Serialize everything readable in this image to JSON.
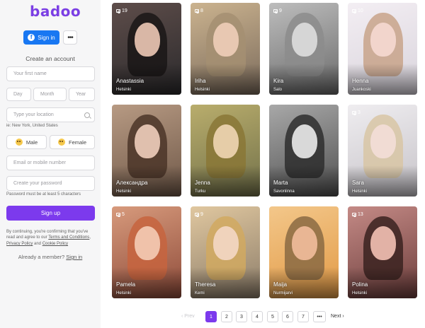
{
  "sidebar": {
    "logo": "badoo",
    "facebook_label": "Sign in",
    "more_label": "•••",
    "create_title": "Create an account",
    "first_name_placeholder": "Your first name",
    "day_placeholder": "Day",
    "month_placeholder": "Month",
    "year_placeholder": "Year",
    "location_placeholder": "Type your location",
    "location_hint": "ie: New York, United States",
    "male_label": "Male",
    "female_label": "Female",
    "email_placeholder": "Email or mobile number",
    "password_placeholder": "Create your password",
    "password_hint": "Password must be at least 5 characters",
    "signup_label": "Sign up",
    "legal_prefix": "By continuing, you're confirming that you've read and agree to our ",
    "terms_label": "Terms and Conditions",
    "legal_sep": ", ",
    "privacy_label": "Privacy Policy",
    "legal_and": " and ",
    "cookie_label": "Cookie Policy",
    "member_prefix": "Already a member? ",
    "member_link": "Sign in"
  },
  "profiles": [
    {
      "name": "Anastassia",
      "city": "Helsinki",
      "photos": "19"
    },
    {
      "name": "Iriha",
      "city": "Helsinki",
      "photos": "8"
    },
    {
      "name": "Kira",
      "city": "Salo",
      "photos": "9"
    },
    {
      "name": "Henna",
      "city": "Juankoski",
      "photos": "10"
    },
    {
      "name": "Александра",
      "city": "Helsinki",
      "photos": ""
    },
    {
      "name": "Jenna",
      "city": "Turku",
      "photos": ""
    },
    {
      "name": "Marta",
      "city": "Savonlinna",
      "photos": ""
    },
    {
      "name": "Sara",
      "city": "Helsinki",
      "photos": "3"
    },
    {
      "name": "Pamela",
      "city": "Helsinki",
      "photos": "5"
    },
    {
      "name": "Theresa",
      "city": "Kemi",
      "photos": "9"
    },
    {
      "name": "Maija",
      "city": "Nurmijarvi",
      "photos": ""
    },
    {
      "name": "Polina",
      "city": "Helsinki",
      "photos": "13"
    }
  ],
  "pagination": {
    "prev": "Prev",
    "pages": [
      "1",
      "2",
      "3",
      "4",
      "5",
      "6",
      "7"
    ],
    "ellipsis": "•••",
    "next": "Next",
    "current_page": 1
  },
  "colors": {
    "brand": "#7b3fe4",
    "signup": "#7c3aed",
    "facebook": "#1877f2"
  }
}
